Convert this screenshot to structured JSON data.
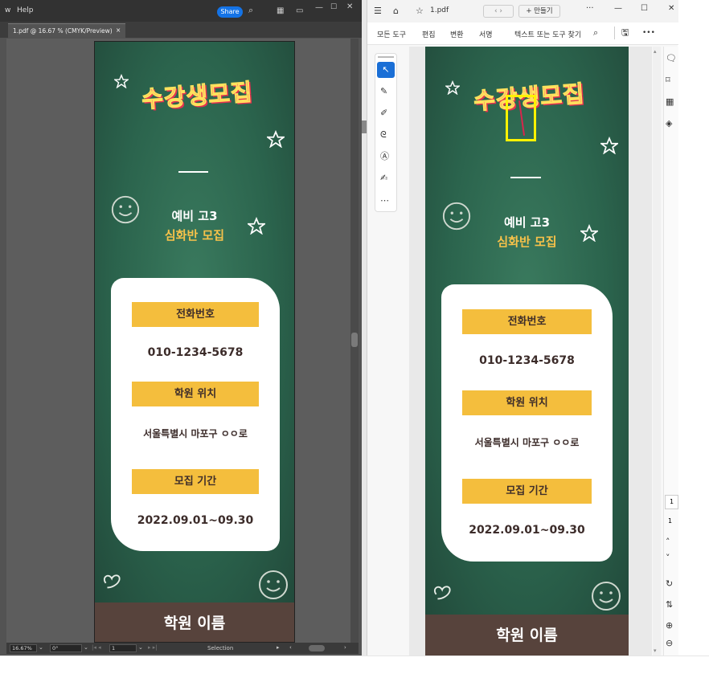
{
  "illustrator": {
    "menu": {
      "partial_item": "w",
      "help": "Help",
      "share": "Share"
    },
    "doc_tab": {
      "label": "1.pdf @ 16.67 % (CMYK/Preview)",
      "close": "×"
    },
    "status": {
      "zoom": "16.67%",
      "rotate": "0°",
      "artboard": "1",
      "tool": "Selection"
    }
  },
  "acrobat": {
    "title_bar": {
      "file_tab": "1.pdf",
      "new_tab": "+ 만들기",
      "more": "···",
      "minimize": "—",
      "maximize": "☐",
      "close": "✕"
    },
    "menu": {
      "all_tools": "모든 도구",
      "edit": "편집",
      "convert": "변환",
      "sign": "서명",
      "find": "텍스트 또는 도구 찾기",
      "more": "•••"
    },
    "page_nav": {
      "current": "1",
      "total": "1"
    }
  },
  "poster": {
    "title": "수강생모집",
    "line1": "예비 고3",
    "line2": "심화반 모집",
    "phone_label": "전화번호",
    "phone_value": "010-1234-5678",
    "location_label": "학원 위치",
    "location_value": "서울특별시 마포구 ㅇㅇ로",
    "period_label": "모집 기간",
    "period_value": "2022.09.01~09.30",
    "footer": "학원 이름"
  },
  "colors": {
    "chalkboard": "#2b644d",
    "title_pink": "#ff4a67",
    "label_yellow": "#f4be3d",
    "footer_brown": "#57433c",
    "share_blue": "#1473e6",
    "selection_yellow": "#fff200",
    "acrobat_active_tool": "#1a6fd6"
  },
  "icons": [
    "home-icon",
    "star-icon",
    "search-icon",
    "layout-icon",
    "hamburger-icon",
    "select-arrow-icon",
    "comment-icon",
    "pen-icon",
    "lasso-icon",
    "text-field-icon",
    "stamp-icon",
    "save-icon",
    "smiley-icon",
    "heart-icon",
    "zoom-in-icon",
    "zoom-out-icon",
    "rotate-icon"
  ]
}
